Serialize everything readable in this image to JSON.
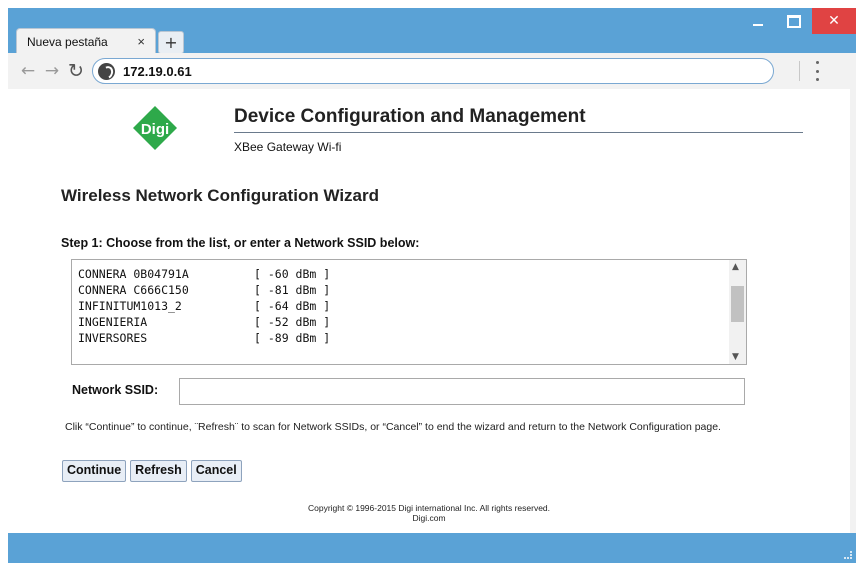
{
  "browser": {
    "tab_title": "Nueva pestaña",
    "tab_close": "×",
    "new_tab": "+",
    "url": "172.19.0.61",
    "controls": {
      "minimize": "",
      "maximize": "",
      "close": "✕"
    },
    "icons": [
      "back-arrow-icon",
      "forward-arrow-icon",
      "reload-icon",
      "globe-icon",
      "menu-icon"
    ]
  },
  "header": {
    "logo_text": "Digi",
    "title": "Device Configuration and Management",
    "subtitle": "XBee Gateway Wi-fi"
  },
  "wizard": {
    "title": "Wireless Network Configuration Wizard",
    "step": "Step 1: Choose from the list, or enter a Network SSID below:",
    "networks": [
      {
        "ssid": "CONNERA 0B04791A",
        "signal": "[ -60 dBm ]"
      },
      {
        "ssid": "CONNERA C666C150",
        "signal": "[ -81 dBm ]"
      },
      {
        "ssid": "INFINITUM1013_2",
        "signal": "[ -64 dBm ]"
      },
      {
        "ssid": "INGENIERIA",
        "signal": "[ -52 dBm ]"
      },
      {
        "ssid": "INVERSORES",
        "signal": "[ -89 dBm ]"
      }
    ],
    "ssid_label": "Network SSID:",
    "ssid_value": "",
    "help_text": "Clik “Continue” to continue, ¨Refresh¨ to scan for Network SSIDs, or “Cancel” to end the wizard and return to the Network Configuration page.",
    "buttons": {
      "continue": "Continue",
      "refresh": "Refresh",
      "cancel": "Cancel"
    }
  },
  "footer": {
    "copyright": "Copyright © 1996-2015 Digi international Inc. All rights reserved.",
    "link": "Digi.com"
  },
  "colors": {
    "window_frame": "#5aa2d6",
    "close_button": "#e04343",
    "logo_green": "#2ea94a"
  }
}
